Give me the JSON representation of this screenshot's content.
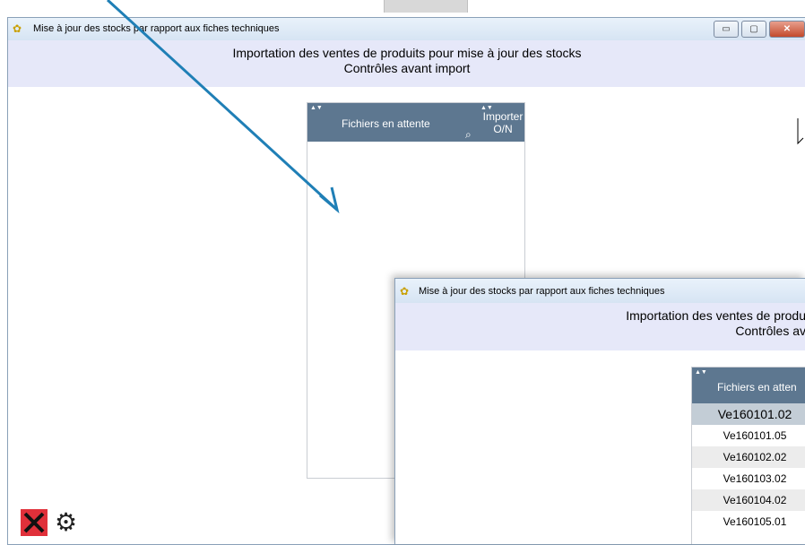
{
  "background": {
    "accent": "#1f7fb6"
  },
  "window_main": {
    "title": "Mise à jour des stocks par rapport aux fiches techniques",
    "title_icon": "app-icon",
    "header_line1": "Importation des ventes de produits pour mise à jour des stocks",
    "header_line2": "Contrôles avant import",
    "controls": {
      "minimize": "▭",
      "maximize": "▢",
      "close": "✕"
    },
    "grid": {
      "col1_header": "Fichiers en attente",
      "col2_header_line1": "Importer",
      "col2_header_line2": "O/N",
      "search_icon": "search-icon",
      "rows": []
    },
    "tools": {
      "close_icon": "close-icon",
      "settings_icon": "gear-icon"
    }
  },
  "window_second": {
    "title": "Mise à jour des stocks par rapport aux fiches techniques",
    "header_line1": "Importation des ventes de produ",
    "header_line2": "Contrôles av",
    "grid": {
      "col1_header": "Fichiers en atten",
      "rows": [
        "Ve160101.02",
        "Ve160101.05",
        "Ve160102.02",
        "Ve160103.02",
        "Ve160104.02",
        "Ve160105.01"
      ]
    }
  }
}
